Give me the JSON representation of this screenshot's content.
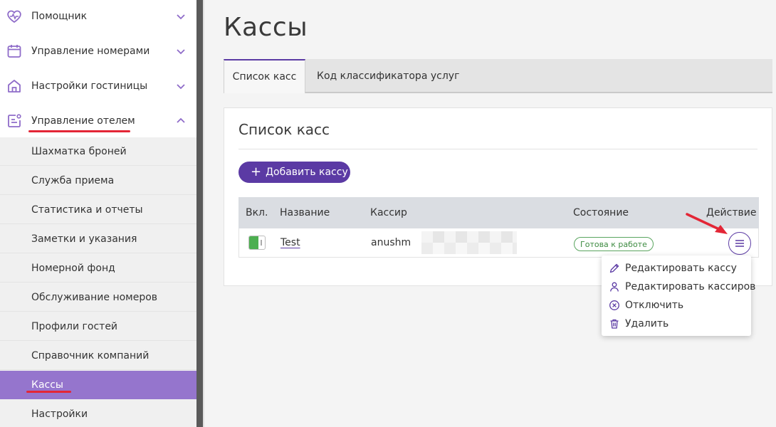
{
  "sidebar": {
    "nav": [
      {
        "label": "Помощник",
        "icon": "heart-pulse-icon"
      },
      {
        "label": "Управление номерами",
        "icon": "calendar-icon"
      },
      {
        "label": "Настройки гостиницы",
        "icon": "home-icon"
      },
      {
        "label": "Управление отелем",
        "icon": "document-settings-icon"
      }
    ],
    "sub_items": [
      {
        "label": "Шахматка броней"
      },
      {
        "label": "Служба приема"
      },
      {
        "label": "Статистика и отчеты"
      },
      {
        "label": "Заметки и указания"
      },
      {
        "label": "Номерной фонд"
      },
      {
        "label": "Обслуживание номеров"
      },
      {
        "label": "Профили гостей"
      },
      {
        "label": "Справочник компаний"
      },
      {
        "label": "Кассы",
        "active": true
      },
      {
        "label": "Настройки"
      }
    ]
  },
  "main": {
    "title": "Кассы",
    "tabs": [
      {
        "label": "Список касс",
        "active": true
      },
      {
        "label": "Код классификатора услуг"
      }
    ],
    "card": {
      "title": "Список касс",
      "add_button": "Добавить кассу",
      "columns": [
        "Вкл.",
        "Название",
        "Кассир",
        "Состояние",
        "Действие"
      ],
      "rows": [
        {
          "enabled": true,
          "name": "Test",
          "cashier": "anushm",
          "status": "Готова к работе"
        }
      ]
    },
    "action_menu": [
      {
        "label": "Редактировать кассу",
        "icon": "pencil-icon"
      },
      {
        "label": "Редактировать кассиров",
        "icon": "user-icon"
      },
      {
        "label": "Отключить",
        "icon": "x-circle-icon"
      },
      {
        "label": "Удалить",
        "icon": "trash-icon"
      }
    ]
  },
  "colors": {
    "accent": "#5b3aa4",
    "active_sidebar": "#9575cd",
    "status_green": "#3d8b41",
    "annotation_red": "#e32636"
  }
}
